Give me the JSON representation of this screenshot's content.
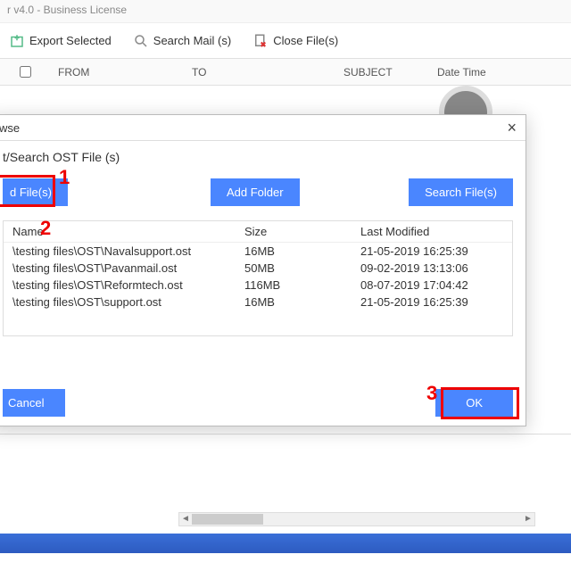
{
  "window": {
    "title": "r v4.0 - Business License"
  },
  "toolbar": {
    "export": "Export Selected",
    "search": "Search Mail (s)",
    "close": "Close File(s)"
  },
  "columns": {
    "from": "FROM",
    "to": "TO",
    "subject": "SUBJECT",
    "datetime": "Date Time"
  },
  "dialog": {
    "title": "wse",
    "subtitle": "t/Search OST File (s)",
    "add_file": "d File(s)",
    "add_folder": "Add Folder",
    "search_file": "Search File(s)",
    "headers": {
      "name": "Name",
      "size": "Size",
      "modified": "Last Modified"
    },
    "rows": [
      {
        "name": "\\testing files\\OST\\Navalsupport.ost",
        "size": "16MB",
        "modified": "21-05-2019 16:25:39"
      },
      {
        "name": "\\testing files\\OST\\Pavanmail.ost",
        "size": "50MB",
        "modified": "09-02-2019 13:13:06"
      },
      {
        "name": "\\testing files\\OST\\Reformtech.ost",
        "size": "116MB",
        "modified": "08-07-2019 17:04:42"
      },
      {
        "name": "\\testing files\\OST\\support.ost",
        "size": "16MB",
        "modified": "21-05-2019 16:25:39"
      }
    ],
    "cancel": "Cancel",
    "ok": "OK"
  },
  "annotations": {
    "n1": "1",
    "n2": "2",
    "n3": "3"
  }
}
